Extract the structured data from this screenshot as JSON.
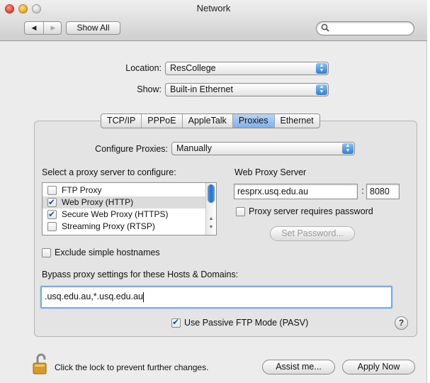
{
  "window": {
    "title": "Network",
    "show_all_label": "Show All",
    "search": {
      "value": "",
      "icon": "magnifier"
    }
  },
  "location": {
    "label": "Location:",
    "value": "ResCollege"
  },
  "show": {
    "label": "Show:",
    "value": "Built-in Ethernet"
  },
  "tabs": [
    {
      "label": "TCP/IP",
      "active": false
    },
    {
      "label": "PPPoE",
      "active": false
    },
    {
      "label": "AppleTalk",
      "active": false
    },
    {
      "label": "Proxies",
      "active": true
    },
    {
      "label": "Ethernet",
      "active": false
    }
  ],
  "proxies": {
    "configure_label": "Configure Proxies:",
    "configure_value": "Manually",
    "select_label": "Select a proxy server to configure:",
    "list": [
      {
        "label": "FTP Proxy",
        "checked": false,
        "selected": false
      },
      {
        "label": "Web Proxy (HTTP)",
        "checked": true,
        "selected": true
      },
      {
        "label": "Secure Web Proxy (HTTPS)",
        "checked": true,
        "selected": false
      },
      {
        "label": "Streaming Proxy (RTSP)",
        "checked": false,
        "selected": false
      }
    ],
    "server_heading": "Web Proxy Server",
    "server_host": "resprx.usq.edu.au",
    "port_separator": ":",
    "server_port": "8080",
    "requires_password_label": "Proxy server requires password",
    "requires_password_checked": false,
    "set_password_label": "Set Password...",
    "exclude_label": "Exclude simple hostnames",
    "exclude_checked": false,
    "bypass_label": "Bypass proxy settings for these Hosts & Domains:",
    "bypass_value": ".usq.edu.au,*.usq.edu.au",
    "passive_ftp_label": "Use Passive FTP Mode (PASV)",
    "passive_ftp_checked": true
  },
  "footer": {
    "lock_text": "Click the lock to prevent further changes.",
    "assist_label": "Assist me...",
    "apply_label": "Apply Now",
    "help_glyph": "?"
  },
  "colors": {
    "accent_blue": "#2e7ed6",
    "selected_tab": "#7fb0e8",
    "window_bg": "#ececec"
  }
}
